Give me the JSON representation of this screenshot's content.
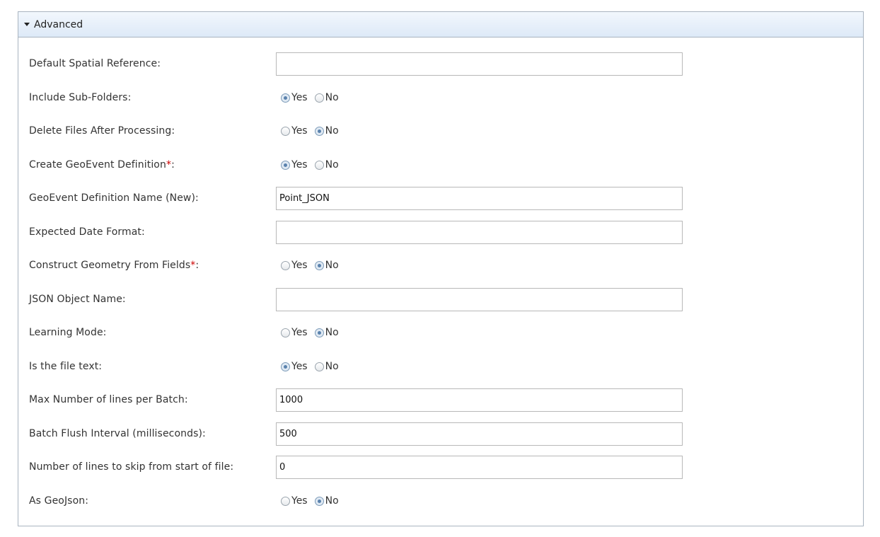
{
  "panel": {
    "title": "Advanced"
  },
  "fields": {
    "default_spatial_reference": {
      "label": "Default Spatial Reference:",
      "value": ""
    },
    "include_sub_folders": {
      "label": "Include Sub-Folders:",
      "selected": "Yes"
    },
    "delete_files_after_processing": {
      "label": "Delete Files After Processing:",
      "selected": "No"
    },
    "create_geoevent_definition": {
      "label": "Create GeoEvent Definition",
      "required_mark": "*",
      "suffix": ":",
      "selected": "Yes"
    },
    "geoevent_definition_name": {
      "label": "GeoEvent Definition Name (New):",
      "value": "Point_JSON"
    },
    "expected_date_format": {
      "label": "Expected Date Format:",
      "value": ""
    },
    "construct_geometry_from_fields": {
      "label": "Construct Geometry From Fields",
      "required_mark": "*",
      "suffix": ":",
      "selected": "No"
    },
    "json_object_name": {
      "label": "JSON Object Name:",
      "value": ""
    },
    "learning_mode": {
      "label": "Learning Mode:",
      "selected": "No"
    },
    "is_the_file_text": {
      "label": "Is the file text:",
      "selected": "Yes"
    },
    "max_lines_per_batch": {
      "label": "Max Number of lines per Batch:",
      "value": "1000"
    },
    "batch_flush_interval": {
      "label": "Batch Flush Interval (milliseconds):",
      "value": "500"
    },
    "lines_to_skip": {
      "label": "Number of lines to skip from start of file:",
      "value": "0"
    },
    "as_geojson": {
      "label": "As GeoJson:",
      "selected": "No"
    }
  },
  "options": {
    "yes": "Yes",
    "no": "No"
  }
}
